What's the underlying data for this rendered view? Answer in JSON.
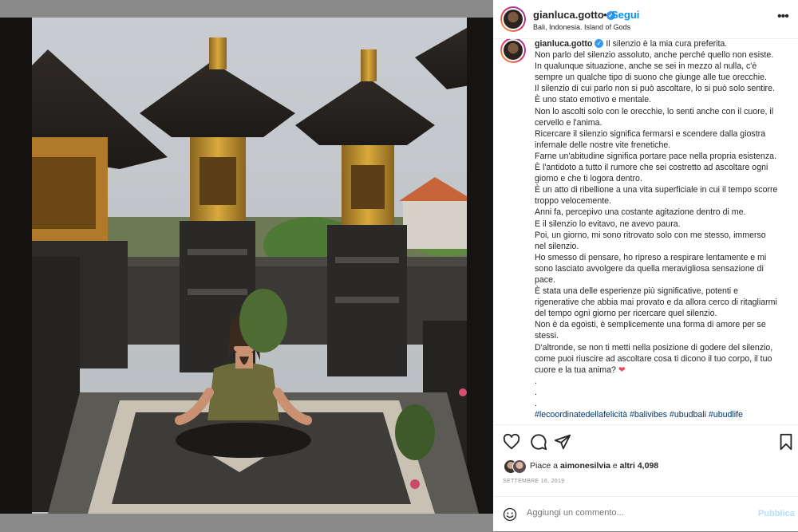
{
  "post": {
    "username": "gianluca.gotto",
    "follow_dot": "•",
    "follow_label": "Segui",
    "location": "Bali, Indonesia. Island of Gods",
    "more_label": "•••"
  },
  "caption": {
    "username": "gianluca.gotto",
    "lines": [
      "Il silenzio è la mia cura preferita.",
      "Non parlo del silenzio assoluto, anche perché quello non esiste.",
      "In qualunque situazione, anche se sei in mezzo al nulla, c'è",
      "sempre un qualche tipo di suono che giunge alle tue orecchie.",
      "Il silenzio di cui parlo non si può ascoltare, lo si può solo sentire.",
      "È uno stato emotivo e mentale.",
      "Non lo ascolti solo con le orecchie, lo senti anche con il cuore, il",
      "cervello e l'anima.",
      "Ricercare il silenzio significa fermarsi e scendere dalla giostra",
      "infernale delle nostre vite frenetiche.",
      "Farne un'abitudine significa portare pace nella propria esistenza.",
      "È l'antidoto a tutto il rumore che sei costretto ad ascoltare ogni",
      "giorno e che ti logora dentro.",
      "È un atto di ribellione a una vita superficiale in cui il tempo scorre",
      "troppo velocemente.",
      "Anni fa, percepivo una costante agitazione dentro di me.",
      "E il silenzio lo evitavo, ne avevo paura.",
      "Poi, un giorno, mi sono ritrovato solo con me stesso, immerso",
      "nel silenzio.",
      "Ho smesso di pensare, ho ripreso a respirare lentamente e mi",
      "sono lasciato avvolgere da quella meravigliosa sensazione di",
      "pace.",
      "È stata una delle esperienze più significative, potenti e",
      "rigenerative che abbia mai provato e da allora cerco di ritagliarmi",
      "del tempo ogni giorno per ricercare quel silenzio.",
      "Non è da egoisti, è semplicemente una forma di amore per se",
      "stessi.",
      "D'altronde, se non ti metti nella posizione di godere del silenzio,",
      "come puoi riuscire ad ascoltare cosa ti dicono il tuo corpo, il tuo"
    ],
    "last_line": "cuore e la tua anima?",
    "heart": "❤",
    "dots": [
      ".",
      ".",
      "."
    ],
    "hashtags": "#lecoordinatedellafelicità #balivibes #ubudbali #ubudlife"
  },
  "actions": {
    "like_icon": "heart-outline-icon",
    "comment_icon": "comment-icon",
    "share_icon": "share-icon",
    "save_icon": "bookmark-icon"
  },
  "likes": {
    "prefix": "Piace a ",
    "user": "aimonesilvia",
    "middle": " e ",
    "others": "altri 4,098"
  },
  "date": "SETTEMBRE 16, 2019",
  "comment_box": {
    "placeholder": "Aggiungi un commento...",
    "publish_label": "Pubblica"
  },
  "colors": {
    "accent": "#0095f6",
    "verified": "#3897f0",
    "hashtag": "#00376b",
    "heart": "#ed4956",
    "backdrop": "#8a8a8a"
  }
}
